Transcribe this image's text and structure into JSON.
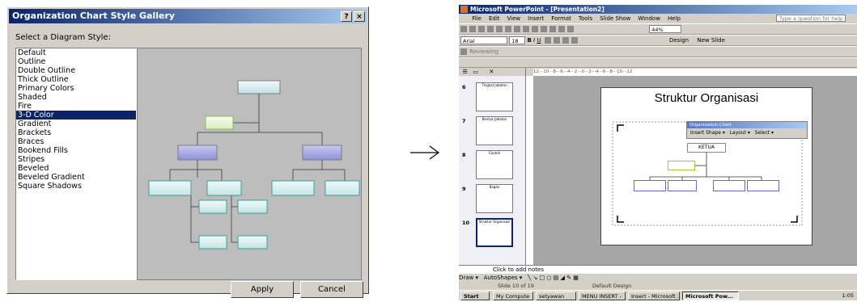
{
  "dialog": {
    "title": "Organization Chart Style Gallery",
    "help_btn": "?",
    "close_btn": "×",
    "prompt": "Select a Diagram Style:",
    "styles": [
      "Default",
      "Outline",
      "Double Outline",
      "Thick Outline",
      "Primary Colors",
      "Shaded",
      "Fire",
      "3-D Color",
      "Gradient",
      "Brackets",
      "Braces",
      "Bookend Fills",
      "Stripes",
      "Beveled",
      "Beveled Gradient",
      "Square Shadows"
    ],
    "selected_index": 7,
    "apply": "Apply",
    "cancel": "Cancel"
  },
  "arrow": {
    "glyph": "⟶"
  },
  "ppt": {
    "title": "Microsoft PowerPoint - [Presentation2]",
    "menu": [
      "File",
      "Edit",
      "View",
      "Insert",
      "Format",
      "Tools",
      "Slide Show",
      "Window",
      "Help"
    ],
    "help_box": "Type a question for help",
    "zoom": "44%",
    "font_name": "Arial",
    "font_size": "18",
    "design_btn": "Design",
    "new_slide_btn": "New Slide",
    "reviewing": "Reviewing",
    "ruler_text": "12···10···8···6···4···2···0···2···4···6···8···10···12",
    "thumbs": [
      {
        "num": "6",
        "text": "Tingkat Jabatan"
      },
      {
        "num": "7",
        "text": "Bentuk Jabatan"
      },
      {
        "num": "8",
        "text": "Contoh"
      },
      {
        "num": "9",
        "text": "Bagan"
      },
      {
        "num": "10",
        "text": "Struktur Organisasi"
      }
    ],
    "slide_title": "Struktur Organisasi",
    "orgbar": {
      "title": "Organization Chart",
      "insert_shape": "Insert Shape",
      "layout": "Layout",
      "select": "Select"
    },
    "ketua": "KETUA",
    "notes": "Click to add notes",
    "draw": "Draw",
    "autoshapes": "AutoShapes",
    "status_slide": "Slide 10 of 19",
    "status_design": "Default Design",
    "taskbar": [
      "Start",
      "My Compute",
      "setyawan",
      "MENU INSERT -",
      "Insert - Microsoft ...",
      "Microsoft Pow..."
    ],
    "clock": "1:05",
    "colors": {
      "accent": "#0a246a",
      "title_end": "#a6caf0"
    }
  }
}
